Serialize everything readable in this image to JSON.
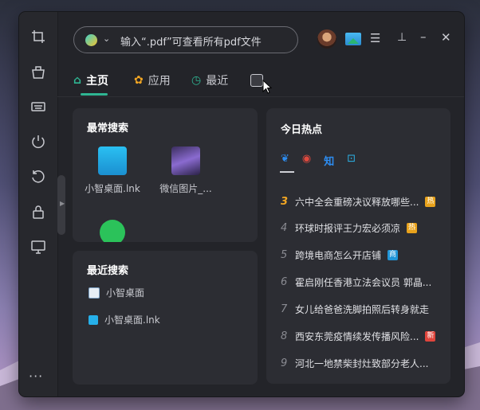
{
  "search": {
    "placeholder": "输入“.pdf”可查看所有pdf文件"
  },
  "tabs": [
    {
      "label": "主页",
      "icon": "home-icon"
    },
    {
      "label": "应用",
      "icon": "apps-icon"
    },
    {
      "label": "最近",
      "icon": "clock-icon"
    }
  ],
  "sidebar": [
    "screenshot-icon",
    "cleanup-icon",
    "keyboard-icon",
    "power-icon",
    "restore-icon",
    "lock-icon",
    "monitor-icon"
  ],
  "frequent": {
    "title": "最常搜索",
    "items": [
      {
        "label": "小智桌面.lnk",
        "icon": "desktop-app-icon"
      },
      {
        "label": "微信图片_...",
        "icon": "image-thumbnail-icon"
      },
      {
        "label": "",
        "icon": "wechat-icon"
      }
    ]
  },
  "recent": {
    "title": "最近搜索",
    "items": [
      {
        "label": "小智桌面",
        "icon": "file-icon"
      },
      {
        "label": "小智桌面.lnk",
        "icon": "desktop-app-icon"
      }
    ]
  },
  "hot": {
    "title": "今日热点",
    "sources": [
      "baidu-icon",
      "weibo-icon",
      "zhihu-icon",
      "bilibili-icon"
    ],
    "zhihu_label": "知",
    "items": [
      {
        "rank": "3",
        "text": "六中全会重磅决议释放哪些...",
        "badge": "热",
        "badge_color": "#e8a21c"
      },
      {
        "rank": "4",
        "text": "环球时报评王力宏必须凉",
        "badge": "热",
        "badge_color": "#e8a21c"
      },
      {
        "rank": "5",
        "text": "跨境电商怎么开店铺",
        "badge": "商",
        "badge_color": "#2196d9"
      },
      {
        "rank": "6",
        "text": "霍启刚任香港立法会议员 郭晶...",
        "badge": "",
        "badge_color": ""
      },
      {
        "rank": "7",
        "text": "女儿给爸爸洗脚拍照后转身就走",
        "badge": "",
        "badge_color": ""
      },
      {
        "rank": "8",
        "text": "西安东莞疫情续发传播风险...",
        "badge": "新",
        "badge_color": "#e0453c"
      },
      {
        "rank": "9",
        "text": "河北一地禁柴封灶致部分老人...",
        "badge": "",
        "badge_color": ""
      }
    ]
  },
  "more_label": "···"
}
